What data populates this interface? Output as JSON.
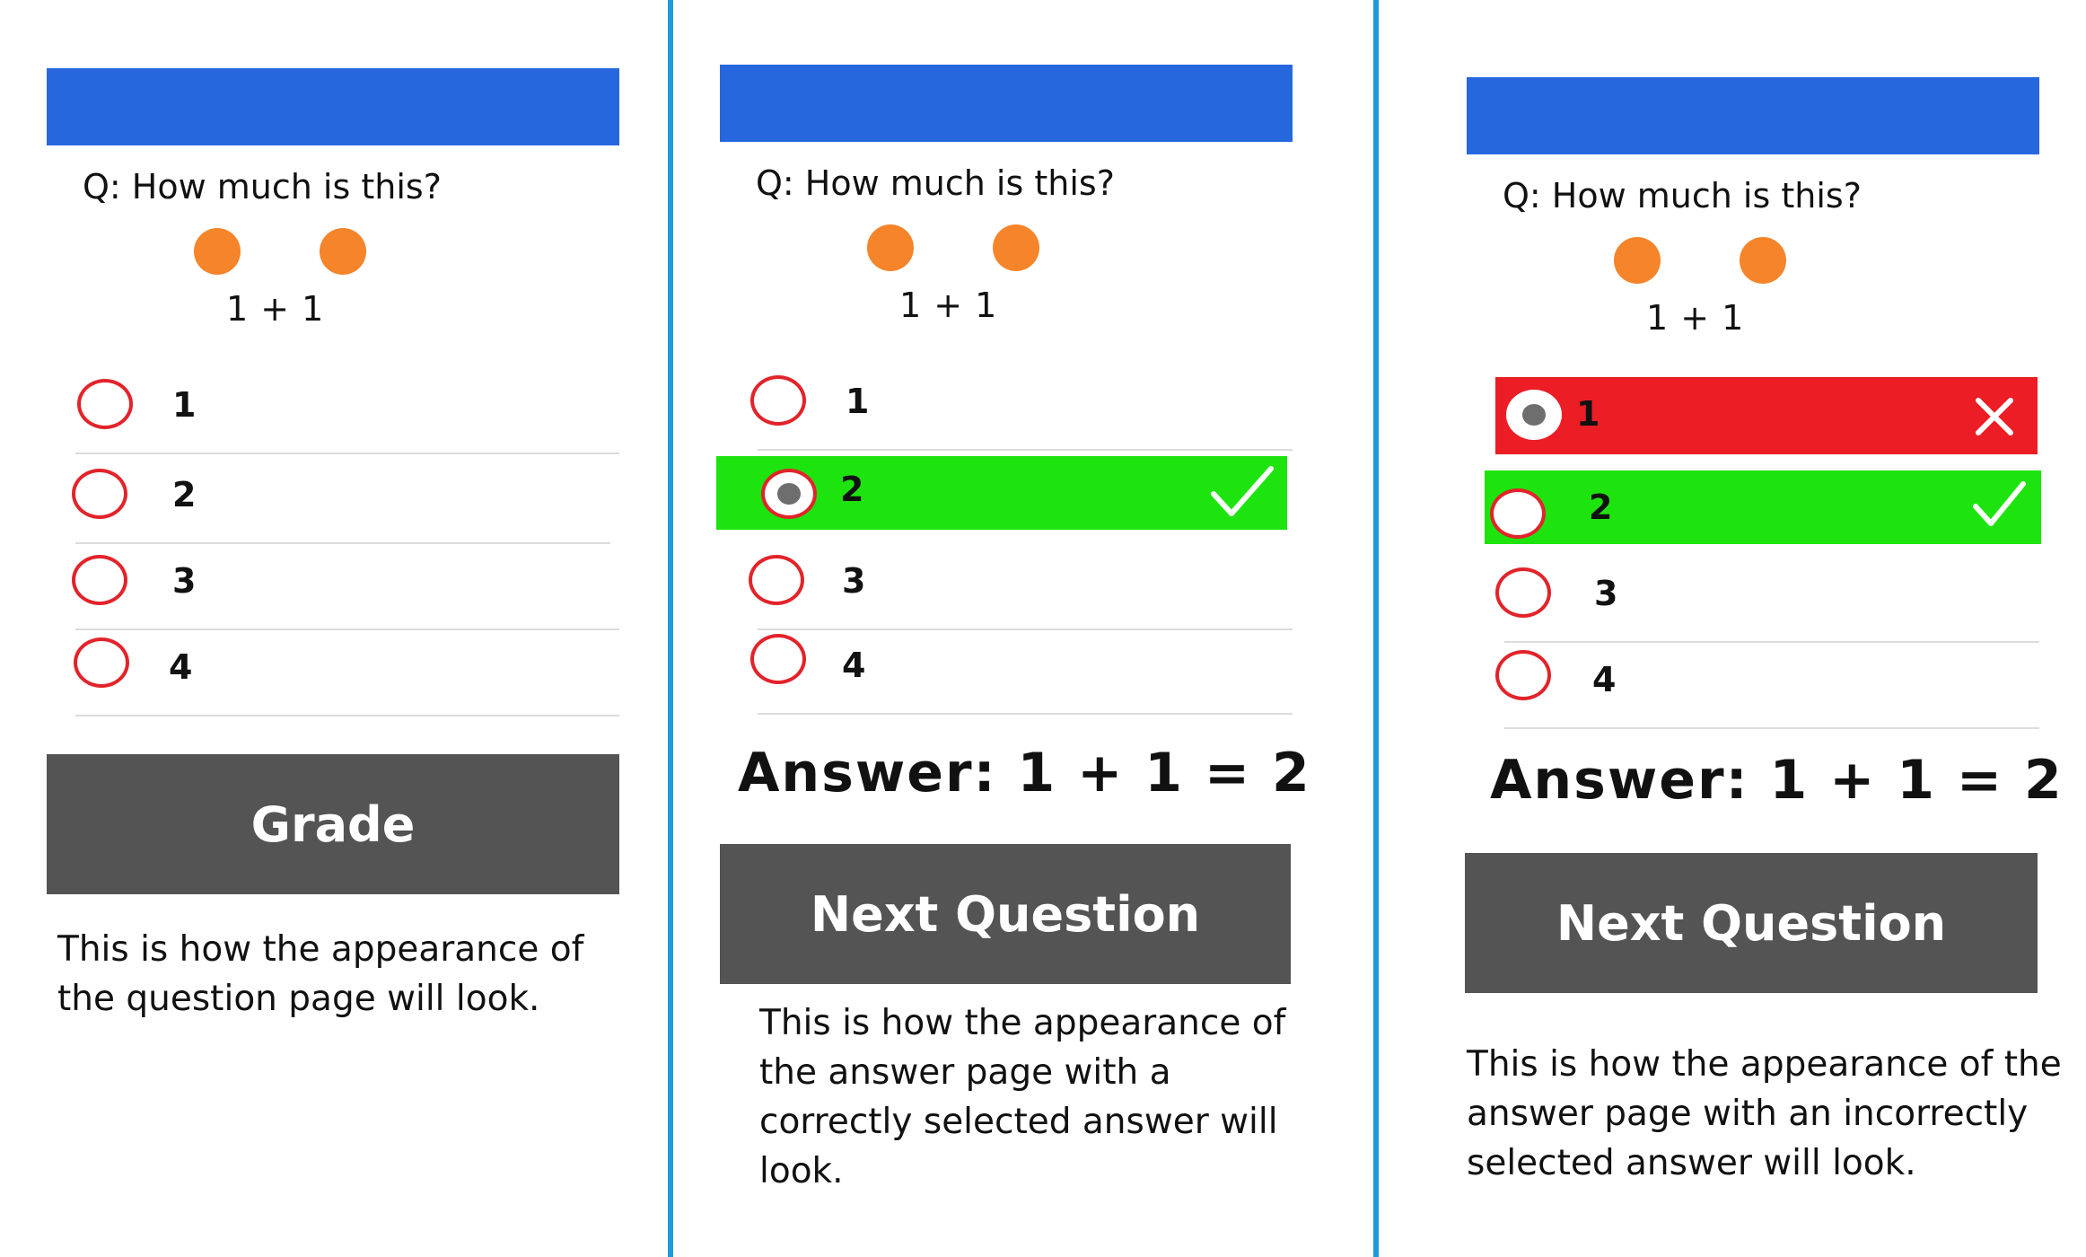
{
  "question_text": "Q: How much is this?",
  "equation_text": "1 + 1",
  "options": [
    "1",
    "2",
    "3",
    "4"
  ],
  "colors": {
    "header": "#2767de",
    "dot": "#f5842a",
    "radio_border": "#e2232a",
    "correct": "#1de40e",
    "wrong": "#ec1d25",
    "button": "#545454",
    "divider": "#1d9bd8"
  },
  "panels": [
    {
      "button_label": "Grade",
      "caption": "This is how the appearance of the question page will look."
    },
    {
      "answer_text": "Answer: 1 + 1 = 2",
      "button_label": "Next Question",
      "caption": "This is how the appearance of the answer page with a correctly selected answer will look."
    },
    {
      "answer_text": "Answer: 1 + 1 = 2",
      "button_label": "Next Question",
      "caption": "This is how the appearance of the answer page with an incorrectly selected answer will look."
    }
  ],
  "icons": {
    "correct": "checkmark-icon",
    "wrong": "x-icon"
  }
}
